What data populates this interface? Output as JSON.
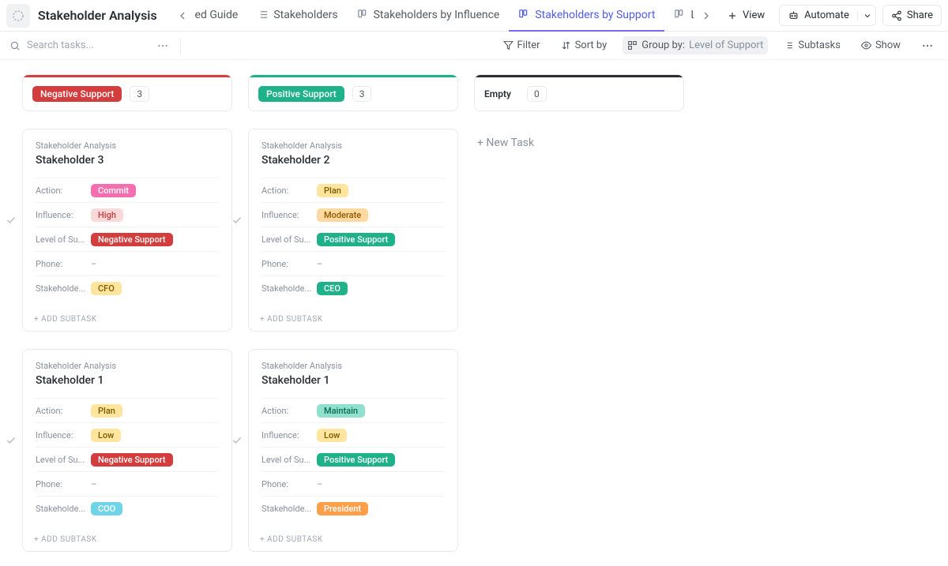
{
  "header": {
    "title": "Stakeholder Analysis",
    "tabs": [
      {
        "label": "ed Guide",
        "partial": true
      },
      {
        "label": "Stakeholders"
      },
      {
        "label": "Stakeholders by Influence"
      },
      {
        "label": "Stakeholders by Support",
        "active": true
      },
      {
        "label": "L",
        "partial_right": true
      }
    ],
    "view": "View",
    "automate": "Automate",
    "share": "Share"
  },
  "toolbar": {
    "search_placeholder": "Search tasks...",
    "filter": "Filter",
    "sort": "Sort by",
    "group_label": "Group by:",
    "group_value": "Level of Support",
    "subtasks": "Subtasks",
    "show": "Show"
  },
  "columns": [
    {
      "name": "Negative Support",
      "count": "3",
      "bar_color": "#d33d3d",
      "pill_bg": "#d33d3d",
      "cards": [
        {
          "breadcrumb": "Stakeholder Analysis",
          "title": "Stakeholder 3",
          "fields": {
            "action": {
              "text": "Commit",
              "bg": "#f66db0",
              "fg": "#fff"
            },
            "influence": {
              "text": "High",
              "bg": "#fbd9d9",
              "fg": "#c13b3b"
            },
            "support": {
              "text": "Negative Support",
              "bg": "#d33d3d",
              "fg": "#fff"
            },
            "phone": "–",
            "role": {
              "text": "CFO",
              "bg": "#ffe59e",
              "fg": "#7a5900"
            }
          }
        },
        {
          "breadcrumb": "Stakeholder Analysis",
          "title": "Stakeholder 1",
          "fields": {
            "action": {
              "text": "Plan",
              "bg": "#ffe59e",
              "fg": "#7a5900"
            },
            "influence": {
              "text": "Low",
              "bg": "#ffe59e",
              "fg": "#7a5900"
            },
            "support": {
              "text": "Negative Support",
              "bg": "#d33d3d",
              "fg": "#fff"
            },
            "phone": "–",
            "role": {
              "text": "COO",
              "bg": "#6fd4e8",
              "fg": "#fff"
            }
          }
        }
      ]
    },
    {
      "name": "Positive Support",
      "count": "3",
      "bar_color": "#1fb28a",
      "pill_bg": "#1fb28a",
      "cards": [
        {
          "breadcrumb": "Stakeholder Analysis",
          "title": "Stakeholder 2",
          "fields": {
            "action": {
              "text": "Plan",
              "bg": "#ffe59e",
              "fg": "#7a5900"
            },
            "influence": {
              "text": "Moderate",
              "bg": "#ffd9a0",
              "fg": "#8a5a00"
            },
            "support": {
              "text": "Positive Support",
              "bg": "#1fb28a",
              "fg": "#fff"
            },
            "phone": "–",
            "role": {
              "text": "CEO",
              "bg": "#1fb28a",
              "fg": "#fff"
            }
          }
        },
        {
          "breadcrumb": "Stakeholder Analysis",
          "title": "Stakeholder 1",
          "fields": {
            "action": {
              "text": "Maintain",
              "bg": "#8fe0cc",
              "fg": "#0d6b52"
            },
            "influence": {
              "text": "Low",
              "bg": "#ffe59e",
              "fg": "#7a5900"
            },
            "support": {
              "text": "Positive Support",
              "bg": "#1fb28a",
              "fg": "#fff"
            },
            "phone": "–",
            "role": {
              "text": "President",
              "bg": "#ff9f4a",
              "fg": "#fff"
            }
          }
        }
      ]
    },
    {
      "name": "Empty",
      "count": "0",
      "bar_color": "#2a2e34",
      "pill_bg": "transparent",
      "pill_fg": "#2a2e34",
      "cards": []
    }
  ],
  "labels": {
    "action": "Action:",
    "influence": "Influence:",
    "support": "Level of Su...",
    "phone": "Phone:",
    "role": "Stakeholde...",
    "add_sub": "+ ADD SUBTASK",
    "new_task": "+ New Task"
  }
}
